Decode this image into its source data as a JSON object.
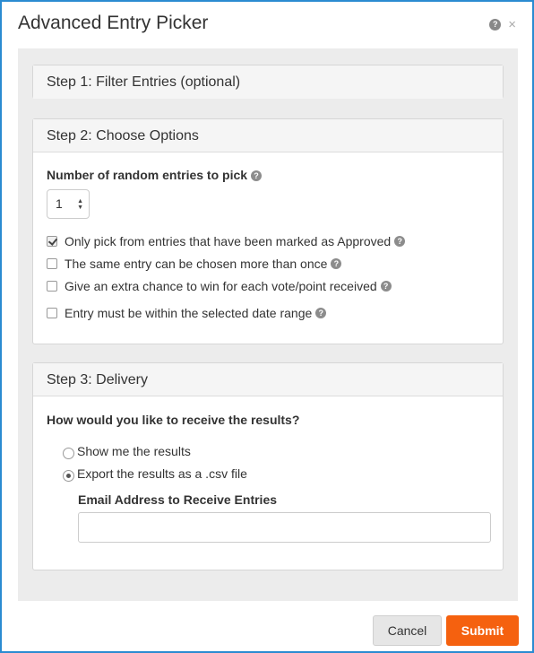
{
  "dialog": {
    "title": "Advanced Entry Picker",
    "help_glyph": "?",
    "close_glyph": "×"
  },
  "step1": {
    "title": "Step 1: Filter Entries (optional)"
  },
  "step2": {
    "title": "Step 2: Choose Options",
    "count_label": "Number of random entries to pick",
    "count_value": "1",
    "options": [
      {
        "label": "Only pick from entries that have been marked as Approved",
        "checked": true
      },
      {
        "label": "The same entry can be chosen more than once",
        "checked": false
      },
      {
        "label": "Give an extra chance to win for each vote/point received",
        "checked": false
      },
      {
        "label": "Entry must be within the selected date range",
        "checked": false
      }
    ]
  },
  "step3": {
    "title": "Step 3: Delivery",
    "question": "How would you like to receive the results?",
    "choices": [
      {
        "label": "Show me the results",
        "selected": false
      },
      {
        "label": "Export the results as a .csv file",
        "selected": true
      }
    ],
    "email_label": "Email Address to Receive Entries",
    "email_value": ""
  },
  "footer": {
    "cancel_label": "Cancel",
    "submit_label": "Submit"
  },
  "colors": {
    "border": "#2a8bd1",
    "submit": "#f5610f",
    "panel_head": "#f5f5f5",
    "body_bg": "#ececec"
  },
  "icons": {
    "help": "help-icon",
    "close": "close-icon",
    "checkbox": "checkbox-icon",
    "radio": "radio-icon",
    "select_arrows": "select-arrows-icon"
  }
}
